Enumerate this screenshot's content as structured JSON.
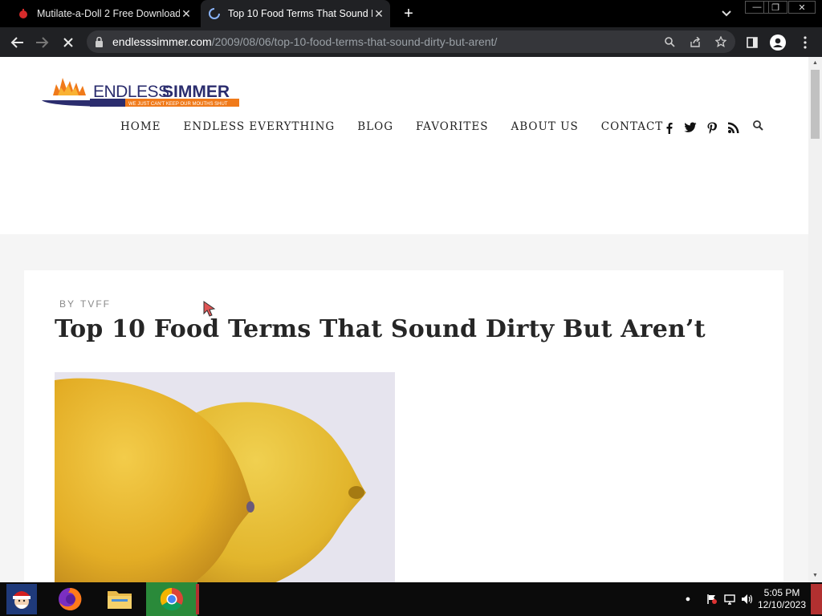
{
  "browser": {
    "tabs": [
      {
        "title": "Mutilate-a-Doll 2 Free Download",
        "active": false
      },
      {
        "title": "Top 10 Food Terms That Sound Dirty But Aren't",
        "active": true
      }
    ],
    "url_host": "endlesssimmer.com",
    "url_path": "/2009/08/06/top-10-food-terms-that-sound-dirty-but-arent/"
  },
  "site": {
    "logo_text_a": "ENDLESS",
    "logo_text_b": "SIMMER",
    "logo_tagline": "WE JUST CAN'T KEEP OUR MOUTHS SHUT",
    "nav": [
      "HOME",
      "ENDLESS EVERYTHING",
      "BLOG",
      "FAVORITES",
      "ABOUT US",
      "CONTACT"
    ],
    "social": [
      "facebook-icon",
      "twitter-icon",
      "pinterest-icon",
      "rss-icon"
    ]
  },
  "article": {
    "by_label": "BY",
    "author": "TVFF",
    "title": "Top 10 Food Terms That Sound Dirty But Aren’t"
  },
  "taskbar": {
    "time": "5:05 PM",
    "date": "12/10/2023"
  },
  "colors": {
    "logo_orange": "#f07a1a",
    "logo_navy": "#2b2d6e",
    "chrome_bg": "#202124",
    "lemon": "#e8b92e"
  }
}
